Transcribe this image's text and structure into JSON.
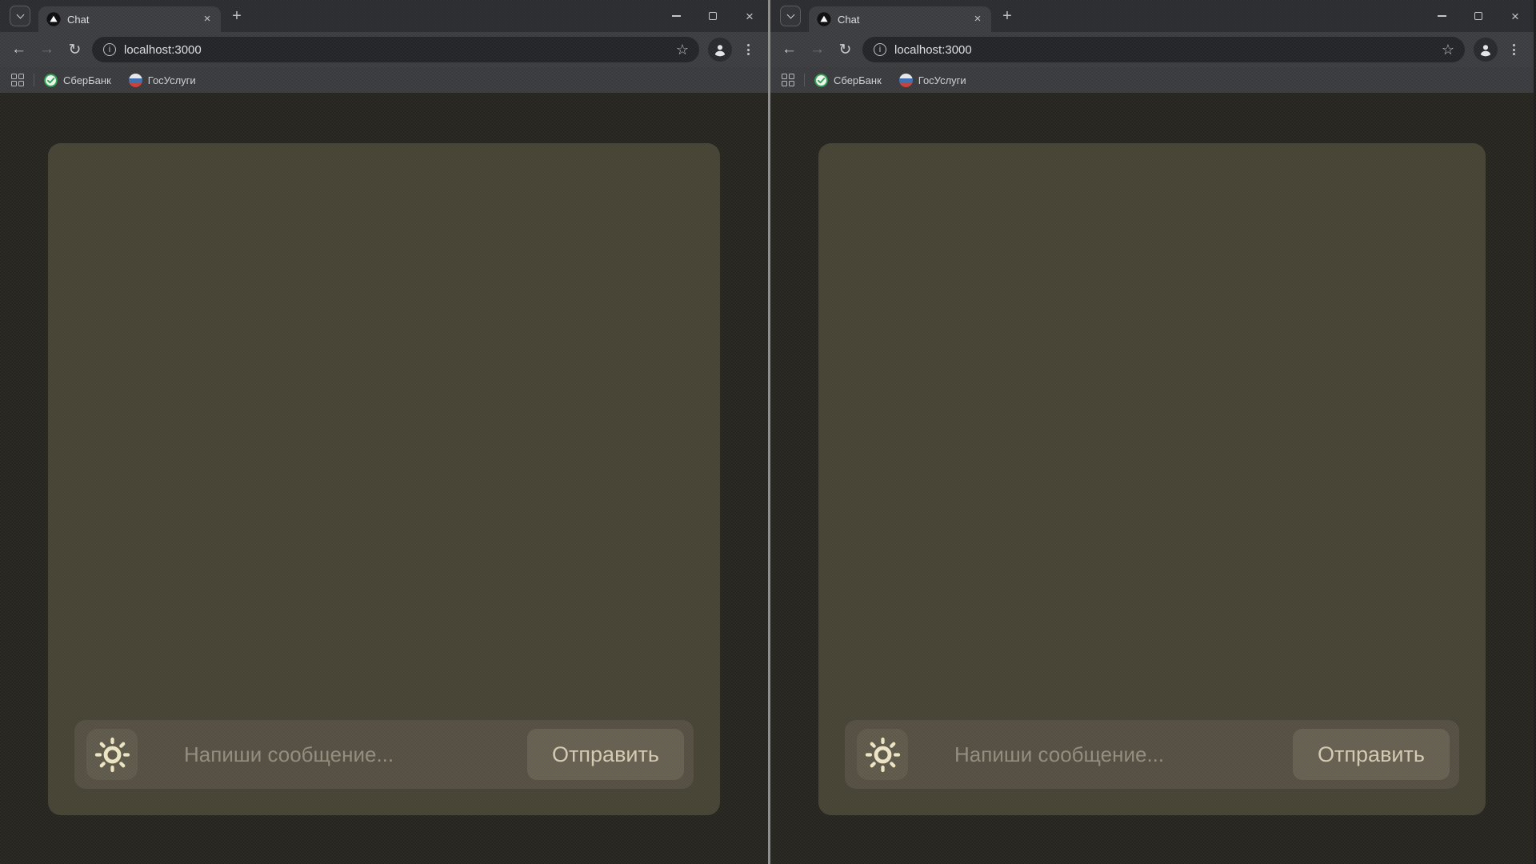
{
  "windows": [
    {
      "side": "left",
      "tab_title": "Chat",
      "url": "localhost:3000",
      "bookmarks": [
        {
          "label": "СберБанк",
          "icon": "sberbank-icon"
        },
        {
          "label": "ГосУслуги",
          "icon": "gosuslugi-icon"
        }
      ],
      "chat": {
        "input_placeholder": "Напиши сообщение...",
        "send_label": "Отправить",
        "theme_icon": "sun-icon"
      }
    },
    {
      "side": "right",
      "tab_title": "Chat",
      "url": "localhost:3000",
      "bookmarks": [
        {
          "label": "СберБанк",
          "icon": "sberbank-icon"
        },
        {
          "label": "ГосУслуги",
          "icon": "gosuslugi-icon"
        }
      ],
      "chat": {
        "input_placeholder": "Напиши сообщение...",
        "send_label": "Отправить",
        "theme_icon": "sun-icon"
      }
    }
  ],
  "icons": {
    "back": "←",
    "forward": "→",
    "reload": "↻",
    "plus": "+",
    "tab_close": "×",
    "window_close": "×",
    "star": "☆",
    "info": "i",
    "favicon": "triangle-in-circle",
    "browser_menu": "kebab-three-dots",
    "bookmarks_apps": "grid-2x2"
  },
  "colors": {
    "chrome_frame": "#292a2e",
    "chrome_toolbar": "#3a3b3f",
    "url_field_bg": "#212226",
    "chrome_text": "#dfe1e5",
    "page_bg": "#24231e",
    "panel_bg": "#454233",
    "input_bar_bg": "#544e41",
    "button_bg": "#665f50",
    "sun_icon": "#f1e8c6",
    "send_text": "#d9cdb3",
    "placeholder_text": "#958e7d",
    "window_divider": "#8f8f8f",
    "sber_green": "#2ea84f",
    "gosuslugi_blue": "#3e6fb2",
    "gosuslugi_red": "#c8403c"
  }
}
